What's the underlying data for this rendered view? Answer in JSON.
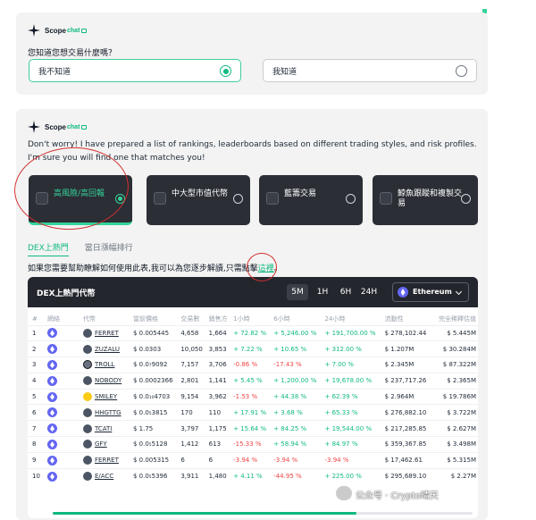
{
  "brand": {
    "name": "Scope",
    "ai": "chat"
  },
  "question_card": {
    "question": "您知道您想交易什麼嗎？",
    "options": [
      {
        "label": "我不知道",
        "selected": true
      },
      {
        "label": "我知道",
        "selected": false
      }
    ]
  },
  "strategy_card": {
    "intro": "Don't worry! I have prepared a list of rankings, leaderboards based on different trading styles, and risk profiles. I'm sure you will find one that matches you!",
    "strategies": [
      {
        "label": "高風險/高回報",
        "selected": true
      },
      {
        "label": "中大型市值代幣",
        "selected": false
      },
      {
        "label": "藍籌交易",
        "selected": false
      },
      {
        "label": "鯨魚跟蹤和複製交易",
        "selected": false
      }
    ],
    "subtabs": [
      "DEX上熱門",
      "當日漲幅排行"
    ],
    "help_text": "如果您需要幫助瞭解如何使用此表,我可以為您逐步解讀,只需點擊",
    "help_link": "這裡",
    "help_suffix": "。"
  },
  "table": {
    "title": "DEX上熱門代幣",
    "timeframes": [
      "5M",
      "1H",
      "6H",
      "24H"
    ],
    "active_timeframe": "5M",
    "chain": "Ethereum",
    "columns": [
      "#",
      "網絡",
      "代幣",
      "當前價格",
      "交易數",
      "銷售方",
      "1小時",
      "6小時",
      "24小時",
      "流動性",
      "完全稀釋估值"
    ],
    "rows": [
      {
        "n": "1",
        "token": "FERRET",
        "icon": "dark",
        "price": "$ 0.005445",
        "txns": "4,658",
        "makers": "1,664",
        "h1": "+ 72.82 %",
        "h6": "+ 5,246.00 %",
        "h24": "+ 191,700.00 %",
        "liq": "$ 278,102.44",
        "fdv": "$ 5.445M"
      },
      {
        "n": "2",
        "token": "ZUZALU",
        "icon": "dark",
        "price": "$ 0.0303",
        "txns": "10,050",
        "makers": "3,853",
        "h1": "+ 7.22 %",
        "h6": "+ 10.65 %",
        "h24": "+ 312.00 %",
        "liq": "$ 1.207M",
        "fdv": "$ 30.284M"
      },
      {
        "n": "3",
        "token": "TROLL",
        "icon": "frog",
        "price": "$ 0.0₇9092",
        "txns": "7,157",
        "makers": "3,706",
        "h1": "-0.86 %",
        "h6": "-17.43 %",
        "h24": "+ 7.00 %",
        "liq": "$ 2.345M",
        "fdv": "$ 87.322M"
      },
      {
        "n": "4",
        "token": "NOBODY",
        "icon": "dark",
        "price": "$ 0.0002366",
        "txns": "2,801",
        "makers": "1,141",
        "h1": "+ 5.45 %",
        "h6": "+ 1,200.00 %",
        "h24": "+ 19,678.00 %",
        "liq": "$ 237,717.26",
        "fdv": "$ 2.365M"
      },
      {
        "n": "5",
        "token": "SMILEY",
        "icon": "smile",
        "price": "$ 0.0₁₀4703",
        "txns": "9,154",
        "makers": "3,962",
        "h1": "-1.53 %",
        "h6": "+ 44.38 %",
        "h24": "+ 62.39 %",
        "liq": "$ 2.964M",
        "fdv": "$ 19.786M"
      },
      {
        "n": "6",
        "token": "HHGTTG",
        "icon": "dark",
        "price": "$ 0.0₅3815",
        "txns": "170",
        "makers": "110",
        "h1": "+ 17.91 %",
        "h6": "+ 3.68 %",
        "h24": "+ 65.33 %",
        "liq": "$ 276,882.10",
        "fdv": "$ 3.722M"
      },
      {
        "n": "7",
        "token": "TCATI",
        "icon": "dark",
        "price": "$ 1.75",
        "txns": "3,797",
        "makers": "1,175",
        "h1": "+ 15.64 %",
        "h6": "+ 84.25 %",
        "h24": "+ 19,544.00 %",
        "liq": "$ 217,285.85",
        "fdv": "$ 2.627M"
      },
      {
        "n": "8",
        "token": "GFY",
        "icon": "dark",
        "price": "$ 0.0₅5128",
        "txns": "1,412",
        "makers": "613",
        "h1": "-15.33 %",
        "h6": "+ 58.94 %",
        "h24": "+ 84.97 %",
        "liq": "$ 359,367.85",
        "fdv": "$ 3.498M"
      },
      {
        "n": "9",
        "token": "FERRET",
        "icon": "dark",
        "price": "$ 0.005315",
        "txns": "6",
        "makers": "6",
        "h1": "-3.94 %",
        "h6": "-3.94 %",
        "h24": "-3.94 %",
        "liq": "$ 17,462.61",
        "fdv": "$ 5.315M"
      },
      {
        "n": "10",
        "token": "E/ACC",
        "icon": "dark",
        "price": "$ 0.0₅5396",
        "txns": "3,911",
        "makers": "1,480",
        "h1": "+ 4.11 %",
        "h6": "-44.95 %",
        "h24": "+ 225.00 %",
        "liq": "$ 295,689.10",
        "fdv": "$ 2.27M"
      }
    ]
  },
  "watermark": "公众号 · Crypto晴天",
  "colors": {
    "accent": "#10b981",
    "dark_card": "#2b2e35",
    "negative": "#ef4444",
    "annotation": "#d32f2f"
  }
}
